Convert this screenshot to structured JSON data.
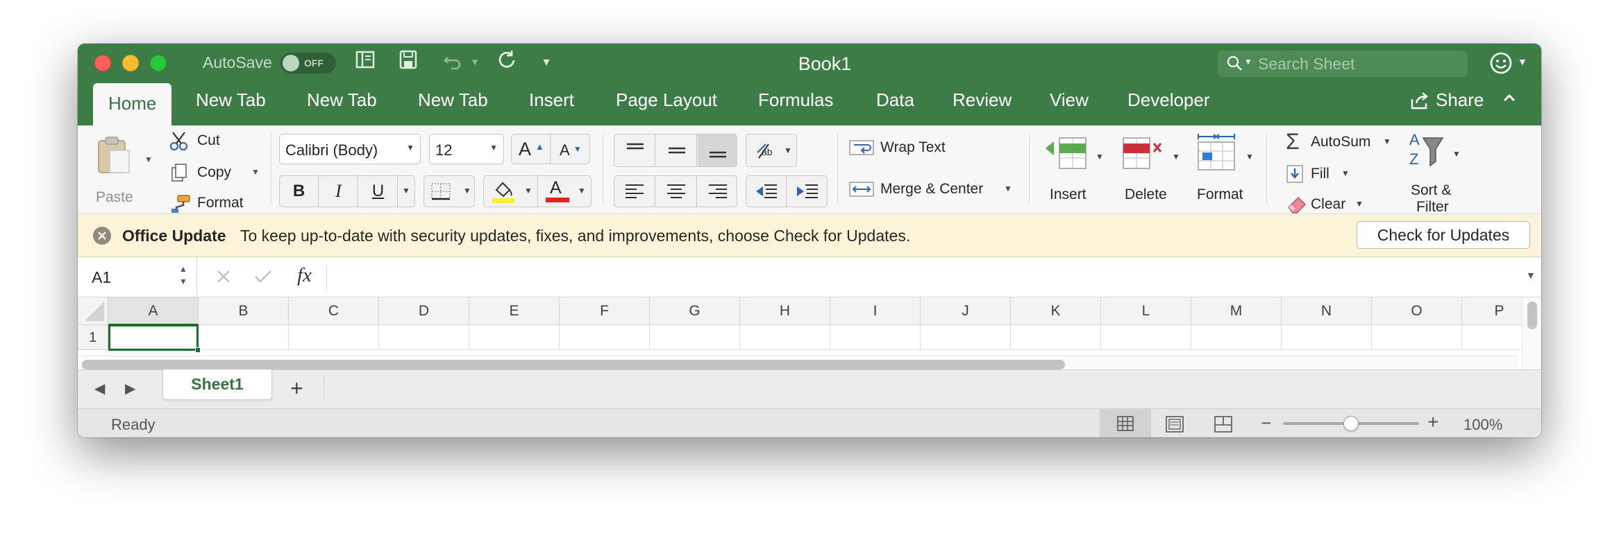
{
  "window": {
    "title": "Book1",
    "autosave_label": "AutoSave",
    "autosave_state": "OFF",
    "search_placeholder": "Search Sheet"
  },
  "tabs": [
    "Home",
    "New Tab",
    "New Tab",
    "New Tab",
    "Insert",
    "Page Layout",
    "Formulas",
    "Data",
    "Review",
    "View",
    "Developer"
  ],
  "share_label": "Share",
  "ribbon": {
    "paste": "Paste",
    "cut": "Cut",
    "copy": "Copy",
    "format_painter": "Format",
    "font_name": "Calibri (Body)",
    "font_size": "12",
    "grow_font": "A",
    "shrink_font": "A",
    "bold": "B",
    "italic": "I",
    "underline": "U",
    "font_color_letter": "A",
    "wrap_text": "Wrap Text",
    "merge_center": "Merge & Center",
    "insert": "Insert",
    "delete": "Delete",
    "format": "Format",
    "autosum": "AutoSum",
    "fill": "Fill",
    "clear": "Clear",
    "sort_filter_line1": "Sort &",
    "sort_filter_line2": "Filter"
  },
  "message_bar": {
    "title": "Office Update",
    "text": "To keep up-to-date with security updates, fixes, and improvements, choose Check for Updates.",
    "button": "Check for Updates"
  },
  "formula_bar": {
    "name_box": "A1",
    "fx": "fx",
    "value": ""
  },
  "grid": {
    "columns": [
      "A",
      "B",
      "C",
      "D",
      "E",
      "F",
      "G",
      "H",
      "I",
      "J",
      "K",
      "L",
      "M",
      "N",
      "O",
      "P"
    ],
    "rows": [
      "1"
    ],
    "selected_cell": "A1"
  },
  "sheet_tabs": {
    "tabs": [
      "Sheet1"
    ],
    "add_label": "+"
  },
  "status_bar": {
    "status": "Ready",
    "zoom": "100%",
    "zoom_level": 0.5
  },
  "colors": {
    "accent": "#3e7c47",
    "font_color_swatch": "#e0241b",
    "highlight_swatch": "#f8ee3c"
  }
}
